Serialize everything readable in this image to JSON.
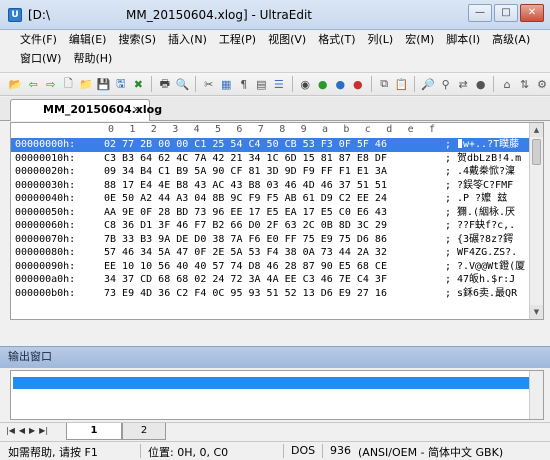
{
  "window": {
    "title_prefix": "[D:\\",
    "title_suffix": "MM_20150604.xlog] - UltraEdit",
    "controls": [
      "—",
      "□",
      "✕"
    ]
  },
  "menu": {
    "row1": [
      "文件(F)",
      "编辑(E)",
      "搜索(S)",
      "插入(N)",
      "工程(P)",
      "视图(V)",
      "格式(T)",
      "列(L)",
      "宏(M)",
      "脚本(I)",
      "高级(A)"
    ],
    "row2": [
      "窗口(W)",
      "帮助(H)"
    ]
  },
  "toolbar_icons": [
    {
      "name": "open-folder-icon",
      "glyph": "📂",
      "color": "#d9a520"
    },
    {
      "name": "back-arrow-icon",
      "glyph": "⇦",
      "color": "#2a9a2a"
    },
    {
      "name": "forward-arrow-icon",
      "glyph": "⇨",
      "color": "#2a9a2a"
    },
    {
      "name": "new-file-icon",
      "glyph": "🗋",
      "color": "#555"
    },
    {
      "name": "open-file-icon",
      "glyph": "📁",
      "color": "#d9a520"
    },
    {
      "name": "save-icon",
      "glyph": "💾",
      "color": "#2a6ec8"
    },
    {
      "name": "save-all-icon",
      "glyph": "🖫",
      "color": "#2a6ec8"
    },
    {
      "name": "close-file-icon",
      "glyph": "✖",
      "color": "#2a8a2a"
    },
    {
      "name": "print-icon",
      "glyph": "🖶",
      "color": "#444"
    },
    {
      "name": "print-preview-icon",
      "glyph": "🔍",
      "color": "#444"
    },
    {
      "name": "cut-icon",
      "glyph": "✂",
      "color": "#555"
    },
    {
      "name": "hex-mode-icon",
      "glyph": "▦",
      "color": "#3a6ec8"
    },
    {
      "name": "word-wrap-icon",
      "glyph": "¶",
      "color": "#555"
    },
    {
      "name": "column-mode-icon",
      "glyph": "▤",
      "color": "#555"
    },
    {
      "name": "list-view-icon",
      "glyph": "☰",
      "color": "#3a6ec8"
    },
    {
      "name": "browser-icon",
      "glyph": "◉",
      "color": "#444"
    },
    {
      "name": "green-forward-icon",
      "glyph": "●",
      "color": "#2a9a2a"
    },
    {
      "name": "blue-back-icon",
      "glyph": "●",
      "color": "#2a6ec8"
    },
    {
      "name": "stop-icon",
      "glyph": "●",
      "color": "#c83030"
    },
    {
      "name": "copy-icon",
      "glyph": "⧉",
      "color": "#555"
    },
    {
      "name": "paste-icon",
      "glyph": "📋",
      "color": "#b88a30"
    },
    {
      "name": "find-icon",
      "glyph": "🔎",
      "color": "#555"
    },
    {
      "name": "find-in-files-icon",
      "glyph": "⚲",
      "color": "#555"
    },
    {
      "name": "replace-icon",
      "glyph": "⇄",
      "color": "#555"
    },
    {
      "name": "macro-record-icon",
      "glyph": "●",
      "color": "#555"
    },
    {
      "name": "tag-list-icon",
      "glyph": "⌂",
      "color": "#555"
    },
    {
      "name": "ftp-icon",
      "glyph": "⇅",
      "color": "#555"
    },
    {
      "name": "settings-icon",
      "glyph": "⚙",
      "color": "#555"
    }
  ],
  "doc_tab": {
    "label": "MM_20150604.xlog",
    "close": "×"
  },
  "hex_columns": [
    "0",
    "1",
    "2",
    "3",
    "4",
    "5",
    "6",
    "7",
    "8",
    "9",
    "a",
    "b",
    "c",
    "d",
    "e",
    "f"
  ],
  "hex_rows": [
    {
      "addr": "00000000h:",
      "bytes": "02 77 2B 00 00 C1 25 54 C4 50 CB 53 F3 0F 5F 46",
      "ascii": "w+..?T瞨藤"
    },
    {
      "addr": "00000010h:",
      "bytes": "C3 B3 64 62 4C 7A 42 21 34 1C 6D 15 81 87 E8 DF",
      "ascii": "贺dbLzB!4.m"
    },
    {
      "addr": "00000020h:",
      "bytes": "09 34 B4 C1 B9 5A 90 CF 81 3D 9D F9 FF F1 E1 3A",
      "ascii": ".4戴桊惞?澟"
    },
    {
      "addr": "00000030h:",
      "bytes": "88 17 E4 4E B8 43 AC 43 B8 03 46 4D 46 37 51 51",
      "ascii": "?鋘笭C?FMF"
    },
    {
      "addr": "00000040h:",
      "bytes": "0E 50 A2 44 A3 04 8B 9C F9 F5 AB 61 D9 C2 EE 24",
      "ascii": ".P ?嬤 玆"
    },
    {
      "addr": "00000050h:",
      "bytes": "AA 9E 0F 28 BD 73 96 EE 17 E5 EA 17 E5 C0 E6 43",
      "ascii": "獮.(絪栐.厌"
    },
    {
      "addr": "00000060h:",
      "bytes": "C8 36 D1 3F 46 F7 B2 66 D0 2F 63 2C 0B 8D 3C 29",
      "ascii": "??F蚗f?c,."
    },
    {
      "addr": "00000070h:",
      "bytes": "7B 33 B3 9A DE D0 38 7A F6 E0 FF 75 E9 75 D6 86",
      "ascii": "{3碾?8z?鍔"
    },
    {
      "addr": "00000080h:",
      "bytes": "57 46 34 5A 47 0F 2E 5A 53 F4 38 0A 73 44 2A 32",
      "ascii": "WF4ZG.ZS?."
    },
    {
      "addr": "00000090h:",
      "bytes": "EE 10 10 56 40 40 57 74 D8 46 28 87 90 E5 68 CE",
      "ascii": "?.V@@Wt鐙(厦"
    },
    {
      "addr": "000000a0h:",
      "bytes": "34 37 CD 68 68 02 24 72 3A 4A EE C3 46 7E C4 3F",
      "ascii": "47皈h.$r:J"
    },
    {
      "addr": "000000b0h:",
      "bytes": "73 E9 4D 36 C2 F4 0C 95 93 51 52 13 D6 E9 27 16",
      "ascii": "s鉌6卖.最QR"
    }
  ],
  "output_window": {
    "title": "输出窗口"
  },
  "sheet_tabs": [
    "1",
    "2"
  ],
  "nav_arrows": [
    "|◀",
    "◀",
    "▶",
    "▶|"
  ],
  "status": {
    "help": "如需帮助, 请按 F1",
    "position": "位置: 0H, 0, C0",
    "line_ending": "DOS",
    "codepage": "936",
    "encoding": "(ANSI/OEM - 简体中文 GBK)"
  }
}
